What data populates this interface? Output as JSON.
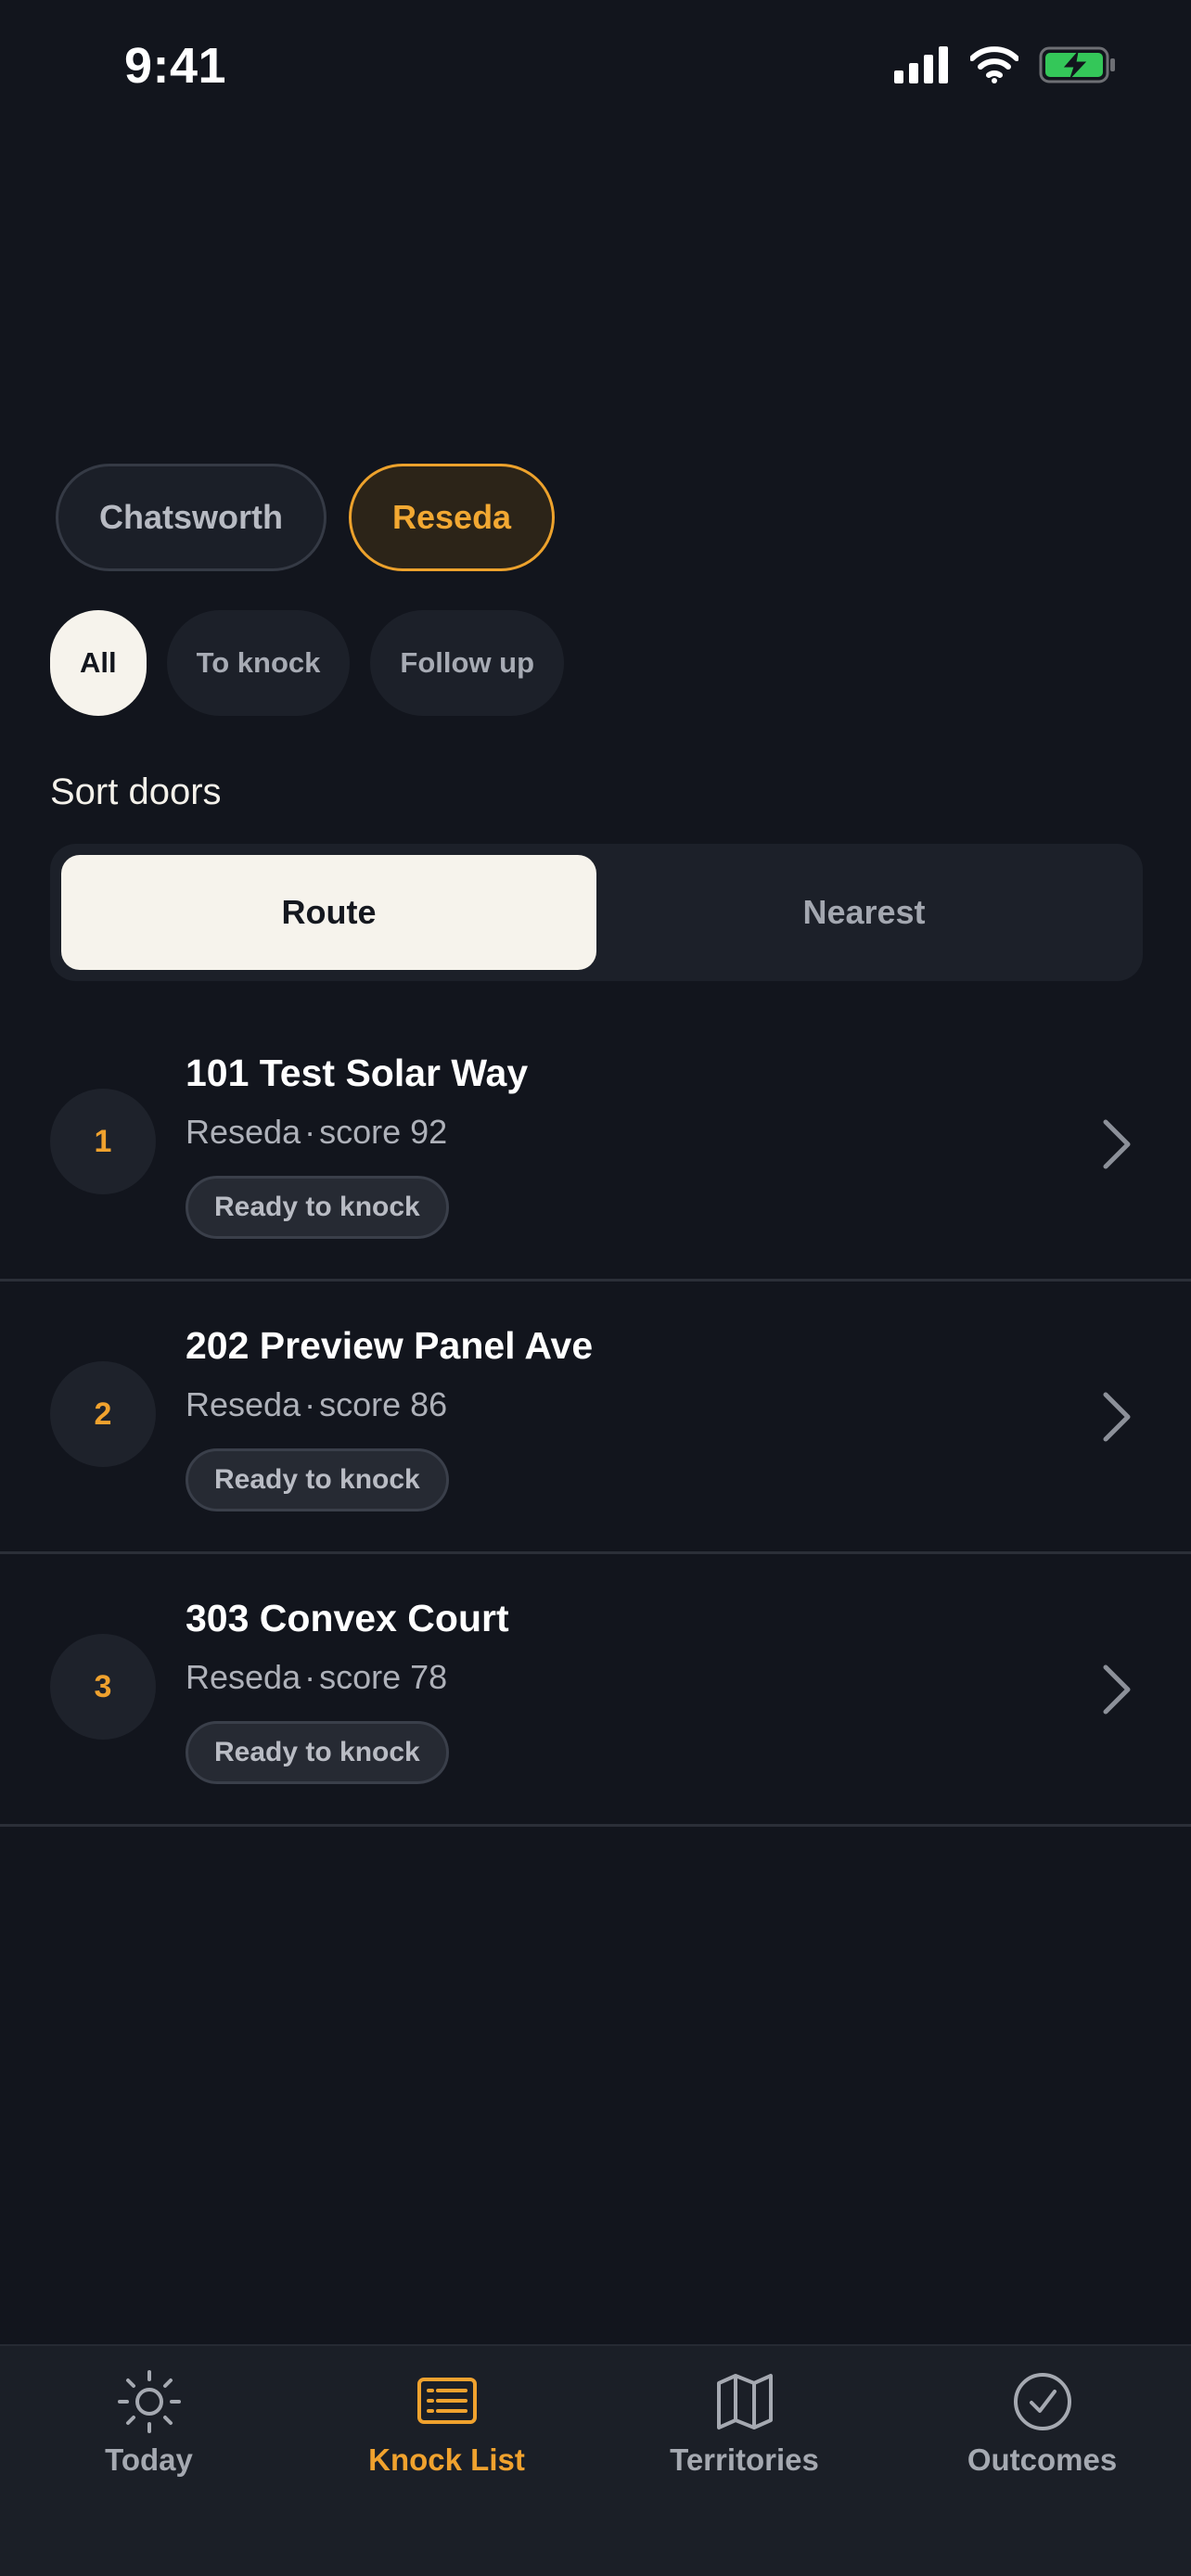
{
  "status_bar": {
    "time": "9:41"
  },
  "territories": [
    {
      "label": "Chatsworth",
      "active": false
    },
    {
      "label": "Reseda",
      "active": true
    }
  ],
  "filters": [
    {
      "label": "All",
      "active": true
    },
    {
      "label": "To knock",
      "active": false
    },
    {
      "label": "Follow up",
      "active": false
    }
  ],
  "sort": {
    "label": "Sort doors",
    "options": [
      {
        "label": "Route",
        "active": true
      },
      {
        "label": "Nearest",
        "active": false
      }
    ]
  },
  "doors": [
    {
      "rank": "1",
      "address": "101 Test Solar Way",
      "area": "Reseda",
      "score": "score 92",
      "status": "Ready to knock"
    },
    {
      "rank": "2",
      "address": "202 Preview Panel Ave",
      "area": "Reseda",
      "score": "score 86",
      "status": "Ready to knock"
    },
    {
      "rank": "3",
      "address": "303 Convex Court",
      "area": "Reseda",
      "score": "score 78",
      "status": "Ready to knock"
    }
  ],
  "tabs": [
    {
      "label": "Today",
      "icon": "sun-icon",
      "active": false
    },
    {
      "label": "Knock List",
      "icon": "list-icon",
      "active": true
    },
    {
      "label": "Territories",
      "icon": "map-icon",
      "active": false
    },
    {
      "label": "Outcomes",
      "icon": "check-circle-icon",
      "active": false
    }
  ],
  "colors": {
    "accent": "#f0a22e",
    "background": "#12151d",
    "surface": "#1c2029",
    "battery": "#34c759"
  }
}
